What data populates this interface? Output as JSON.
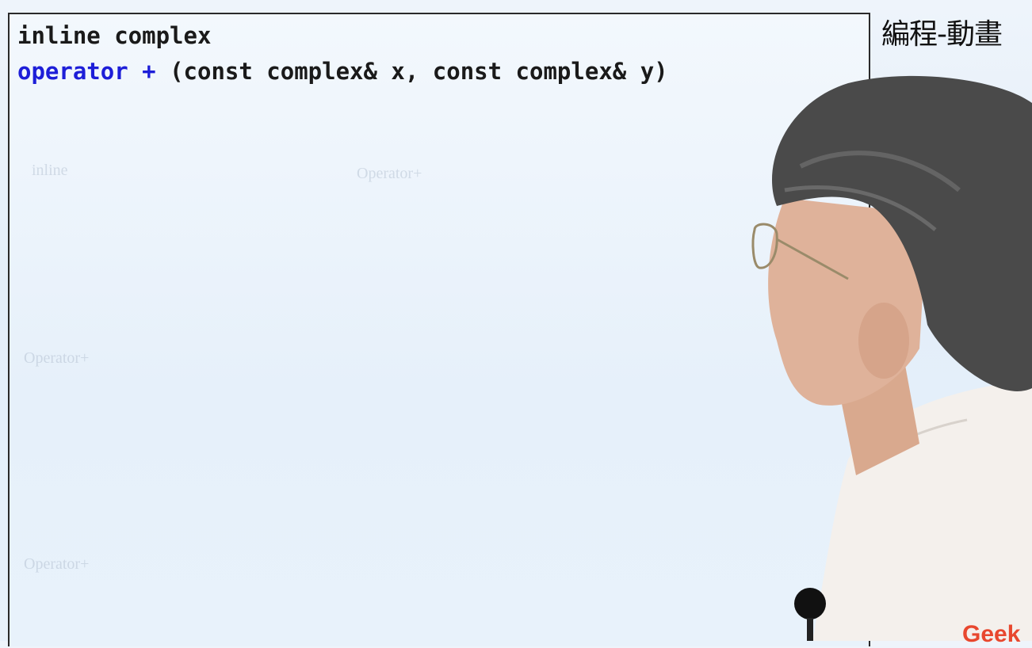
{
  "slide": {
    "line1": "inline complex",
    "line2_keyword": "operator +",
    "line2_rest": " (const complex& x, const complex& y)",
    "watermarks": [
      "inline",
      "Operator+",
      "Operator+",
      "Operator+"
    ]
  },
  "channel_title": "編程-動畫",
  "logo_text": "Geek",
  "colors": {
    "keyword": "#1d1ed8",
    "logo": "#e8472e"
  }
}
